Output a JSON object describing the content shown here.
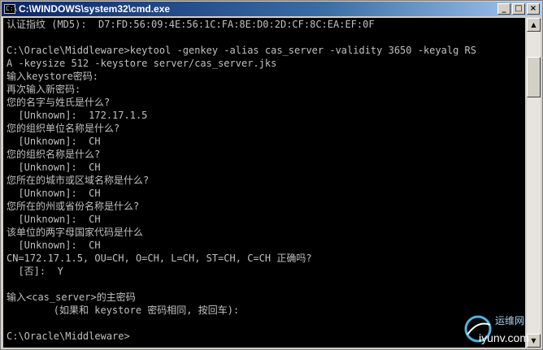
{
  "window": {
    "title": "C:\\WINDOWS\\system32\\cmd.exe",
    "icon_label": "C:\\",
    "buttons": {
      "minimize": "_",
      "maximize": "□",
      "close": "×"
    }
  },
  "console": {
    "lines": [
      "认证指纹 (MD5):  D7:FD:56:09:4E:56:1C:FA:8E:D0:2D:CF:8C:EA:EF:0F",
      "",
      "C:\\Oracle\\Middleware>keytool -genkey -alias cas_server -validity 3650 -keyalg RS",
      "A -keysize 512 -keystore server/cas_server.jks",
      "输入keystore密码:",
      "再次输入新密码:",
      "您的名字与姓氏是什么?",
      "  [Unknown]:  172.17.1.5",
      "您的组织单位名称是什么?",
      "  [Unknown]:  CH",
      "您的组织名称是什么?",
      "  [Unknown]:  CH",
      "您所在的城市或区域名称是什么?",
      "  [Unknown]:  CH",
      "您所在的州或省份名称是什么?",
      "  [Unknown]:  CH",
      "该单位的两字母国家代码是什么",
      "  [Unknown]:  CH",
      "CN=172.17.1.5, OU=CH, O=CH, L=CH, ST=CH, C=CH 正确吗?",
      "  [否]:  Y",
      "",
      "输入<cas_server>的主密码",
      "        (如果和 keystore 密码相同, 按回车):",
      "",
      "C:\\Oracle\\Middleware>"
    ]
  },
  "scrollbar": {
    "up_arrow": "▲",
    "down_arrow": "▼"
  },
  "watermark": {
    "cn": "运维网",
    "url": "iyunv.com"
  },
  "colors": {
    "console_bg": "#000000",
    "console_text": "#c0c0c0",
    "titlebar_start": "#0a246a",
    "titlebar_end": "#a6caf0"
  }
}
